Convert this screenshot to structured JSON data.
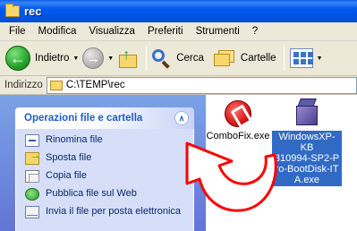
{
  "window": {
    "title": "rec"
  },
  "menu": {
    "items": [
      "File",
      "Modifica",
      "Visualizza",
      "Preferiti",
      "Strumenti",
      "?"
    ]
  },
  "toolbar": {
    "back_label": "Indietro",
    "search_label": "Cerca",
    "folders_label": "Cartelle"
  },
  "address": {
    "label": "Indirizzo",
    "path": "C:\\TEMP\\rec"
  },
  "tasks": {
    "title": "Operazioni file e cartella",
    "items": [
      {
        "label": "Rinomina file",
        "icon": "rename-icon"
      },
      {
        "label": "Sposta file",
        "icon": "move-icon"
      },
      {
        "label": "Copia file",
        "icon": "copy-icon"
      },
      {
        "label": "Pubblica file sul Web",
        "icon": "web-icon"
      },
      {
        "label": "Invia il file per posta elettronica",
        "icon": "mail-icon"
      }
    ]
  },
  "files": [
    {
      "name": "ComboFix.exe",
      "selected": false
    },
    {
      "name": "WindowsXP-KB310994-SP2-Pro-BootDisk-ITA.exe",
      "name_lines": [
        "WindowsXP-KB",
        "310994-SP2-P",
        "ro-BootDisk-IT",
        "A.exe"
      ],
      "selected": true
    }
  ],
  "colors": {
    "titlebar": "#0054e3",
    "selection": "#316ac5",
    "overlay_arrow": "#ff0000"
  }
}
